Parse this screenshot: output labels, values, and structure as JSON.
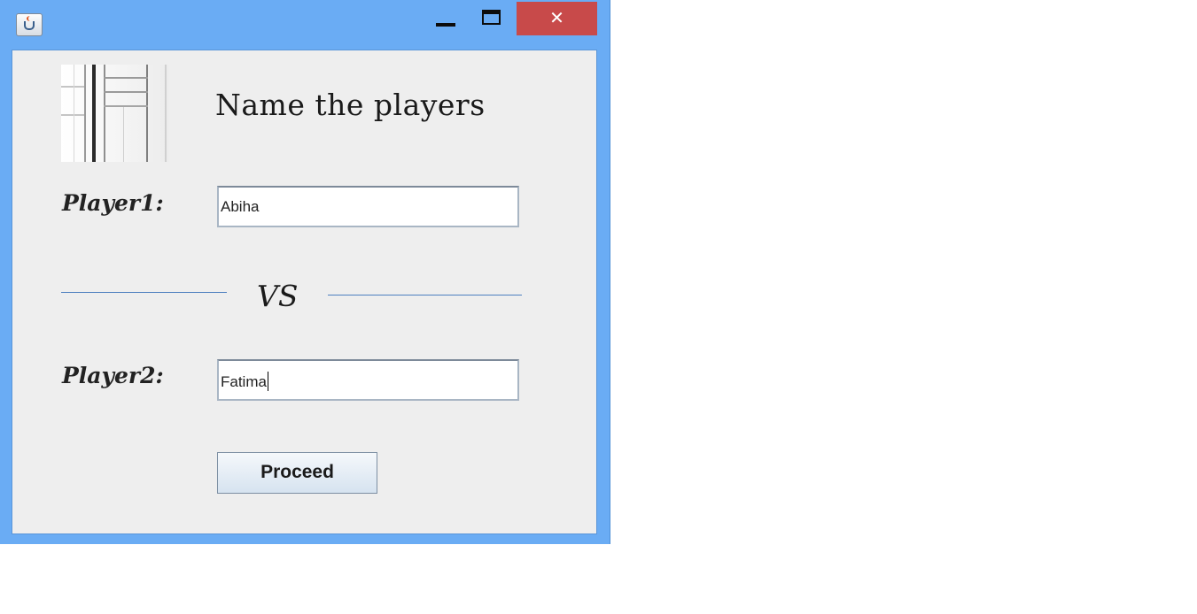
{
  "window": {
    "title": "",
    "controls": {
      "minimize_icon": "minimize-icon",
      "maximize_icon": "maximize-icon",
      "close_label": "✕"
    },
    "colors": {
      "frame": "#6aacf4",
      "close": "#c84a4a",
      "client": "#eeeeee"
    }
  },
  "form": {
    "heading": "Name the players",
    "player1_label": "Player1:",
    "player1_value": "Abiha",
    "vs_label": "VS",
    "player2_label": "Player2:",
    "player2_value": "Fatima",
    "proceed_label": "Proceed"
  }
}
